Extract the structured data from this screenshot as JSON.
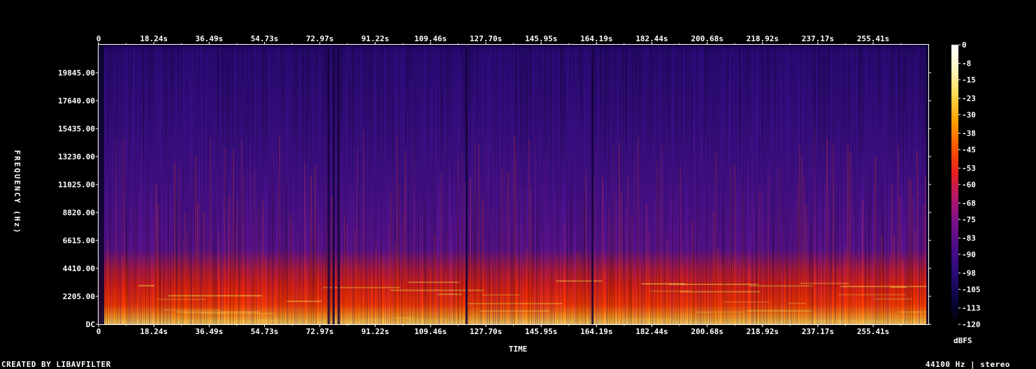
{
  "chart_data": {
    "type": "heatmap",
    "title": "",
    "xlabel": "TIME",
    "ylabel": "FREQUENCY (Hz)",
    "x_ticks": [
      "0",
      "18.24s",
      "36.49s",
      "54.73s",
      "72.97s",
      "91.22s",
      "109.46s",
      "127.70s",
      "145.95s",
      "164.19s",
      "182.44s",
      "200.68s",
      "218.92s",
      "237.17s",
      "255.41s"
    ],
    "x_tick_values_s": [
      0,
      18.24,
      36.49,
      54.73,
      72.97,
      91.22,
      109.46,
      127.7,
      145.95,
      164.19,
      182.44,
      200.68,
      218.92,
      237.17,
      255.41
    ],
    "xlim_s": [
      0,
      273.6
    ],
    "y_ticks": [
      "DC",
      "2205.00",
      "4410.00",
      "6615.00",
      "8820.00",
      "11025.00",
      "13230.00",
      "15435.00",
      "17640.00",
      "19845.00"
    ],
    "y_tick_values_hz": [
      0,
      2205,
      4410,
      6615,
      8820,
      11025,
      13230,
      15435,
      17640,
      19845
    ],
    "ylim_hz": [
      0,
      22050
    ],
    "colorbar": {
      "label": "dBFS",
      "ticks": [
        "0",
        "-8",
        "-15",
        "-23",
        "-30",
        "-38",
        "-45",
        "-53",
        "-60",
        "-68",
        "-75",
        "-83",
        "-90",
        "-98",
        "-105",
        "-113",
        "-120"
      ],
      "tick_values": [
        0,
        -8,
        -15,
        -23,
        -30,
        -38,
        -45,
        -53,
        -60,
        -68,
        -75,
        -83,
        -90,
        -98,
        -105,
        -113,
        -120
      ],
      "range": [
        -120,
        0
      ],
      "colormap": [
        "#000000",
        "#0a0540",
        "#2a0a7a",
        "#4b0c8a",
        "#7a128a",
        "#b4186a",
        "#e8201a",
        "#ff5a00",
        "#ffa000",
        "#ffd84a",
        "#fff6c0",
        "#ffffff"
      ]
    },
    "grid": false,
    "colors": {
      "background": "#000000",
      "low_energy": "#3a108a",
      "mid_energy": "#d01818",
      "high_energy": "#ffc040"
    },
    "dark_gaps_s": [
      75.5,
      77.2,
      78.8,
      162.5,
      121.0
    ],
    "energy_band_hz": [
      0,
      4800
    ]
  },
  "footer": {
    "credit": "CREATED BY LIBAVFILTER",
    "format": "44100 Hz | stereo"
  }
}
